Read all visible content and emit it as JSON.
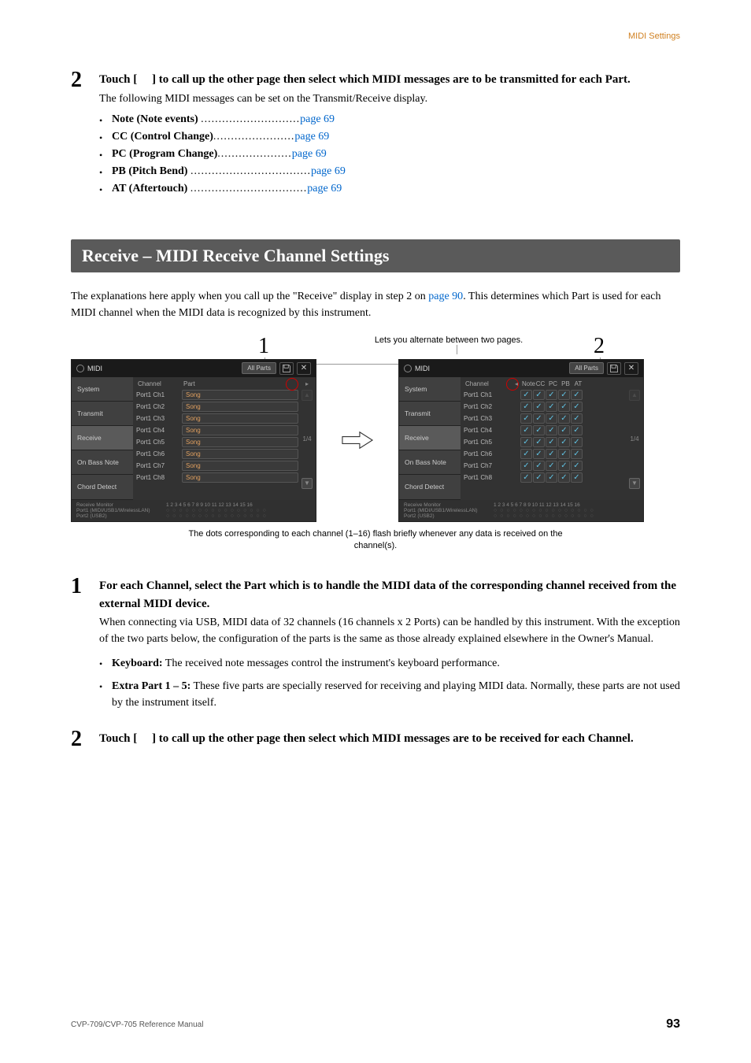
{
  "header": {
    "section": "MIDI Settings"
  },
  "step2top": {
    "num": "2",
    "title_a": "Touch [",
    "title_b": "] to call up the other page then select which MIDI messages are to be transmitted for each Part.",
    "desc": "The following MIDI messages can be set on the Transmit/Receive display.",
    "items": [
      {
        "label": "Note (Note events)",
        "dots": "............................",
        "page": "page 69"
      },
      {
        "label": "CC (Control Change)",
        "dots": ".......................",
        "page": "page 69"
      },
      {
        "label": "PC (Program Change)",
        "dots": ".....................",
        "page": "page 69"
      },
      {
        "label": "PB (Pitch Bend)",
        "dots": "..................................",
        "page": "page 69"
      },
      {
        "label": "AT (Aftertouch)",
        "dots": ".................................",
        "page": "page 69"
      }
    ]
  },
  "section": {
    "title": "Receive – MIDI Receive Channel Settings"
  },
  "intro": {
    "a": "The explanations here apply when you call up the \"Receive\" display in step 2 on ",
    "link": "page 90",
    "b": ". This determines which Part is used for each MIDI channel when the MIDI data is recognized by this instrument."
  },
  "figure": {
    "alternate": "Lets you alternate between two pages.",
    "num1": "1",
    "num2": "2",
    "caption": "The dots corresponding to each channel (1–16) flash briefly whenever any data is received on the channel(s).",
    "panel": {
      "title": "MIDI",
      "all_parts": "All Parts",
      "tabs": [
        "System",
        "Transmit",
        "Receive",
        "On Bass Note",
        "Chord Detect"
      ],
      "pager": "1/4",
      "left": {
        "head": {
          "c1": "Channel",
          "c2": "Part"
        },
        "rows": [
          {
            "ch": "Port1 Ch1",
            "part": "Song"
          },
          {
            "ch": "Port1 Ch2",
            "part": "Song"
          },
          {
            "ch": "Port1 Ch3",
            "part": "Song"
          },
          {
            "ch": "Port1 Ch4",
            "part": "Song"
          },
          {
            "ch": "Port1 Ch5",
            "part": "Song"
          },
          {
            "ch": "Port1 Ch6",
            "part": "Song"
          },
          {
            "ch": "Port1 Ch7",
            "part": "Song"
          },
          {
            "ch": "Port1 Ch8",
            "part": "Song"
          }
        ]
      },
      "right": {
        "head": {
          "c1": "Channel",
          "cols": [
            "Note",
            "CC",
            "PC",
            "PB",
            "AT"
          ]
        },
        "rows": [
          {
            "ch": "Port1 Ch1"
          },
          {
            "ch": "Port1 Ch2"
          },
          {
            "ch": "Port1 Ch3"
          },
          {
            "ch": "Port1 Ch4"
          },
          {
            "ch": "Port1 Ch5"
          },
          {
            "ch": "Port1 Ch6"
          },
          {
            "ch": "Port1 Ch7"
          },
          {
            "ch": "Port1 Ch8"
          }
        ]
      },
      "footer": {
        "label": "Receive Monitor",
        "nums": "1  2  3  4  5  6  7  8  9 10 11 12 13 14 15 16",
        "p1": "Port1 (MIDI/USB1/WirelessLAN)",
        "p2": "Port2 (USB2)"
      }
    }
  },
  "step1": {
    "num": "1",
    "title": "For each Channel, select the Part which is to handle the MIDI data of the corresponding channel received from the external MIDI device.",
    "desc": "When connecting via USB, MIDI data of 32 channels (16 channels x 2 Ports) can be handled by this instrument. With the exception of the two parts below, the configuration of the parts is the same as those already explained elsewhere in the Owner's Manual.",
    "bullets": [
      {
        "label": "Keyboard:",
        "text": " The received note messages control the instrument's keyboard performance."
      },
      {
        "label": "Extra Part 1 – 5:",
        "text": " These five parts are specially reserved for receiving and playing MIDI data. Normally, these parts are not used by the instrument itself."
      }
    ]
  },
  "step2bot": {
    "num": "2",
    "title_a": "Touch [",
    "title_b": "] to call up the other page then select which MIDI messages are to be received for each Channel."
  },
  "footer": {
    "ref": "CVP-709/CVP-705 Reference Manual",
    "page": "93"
  }
}
